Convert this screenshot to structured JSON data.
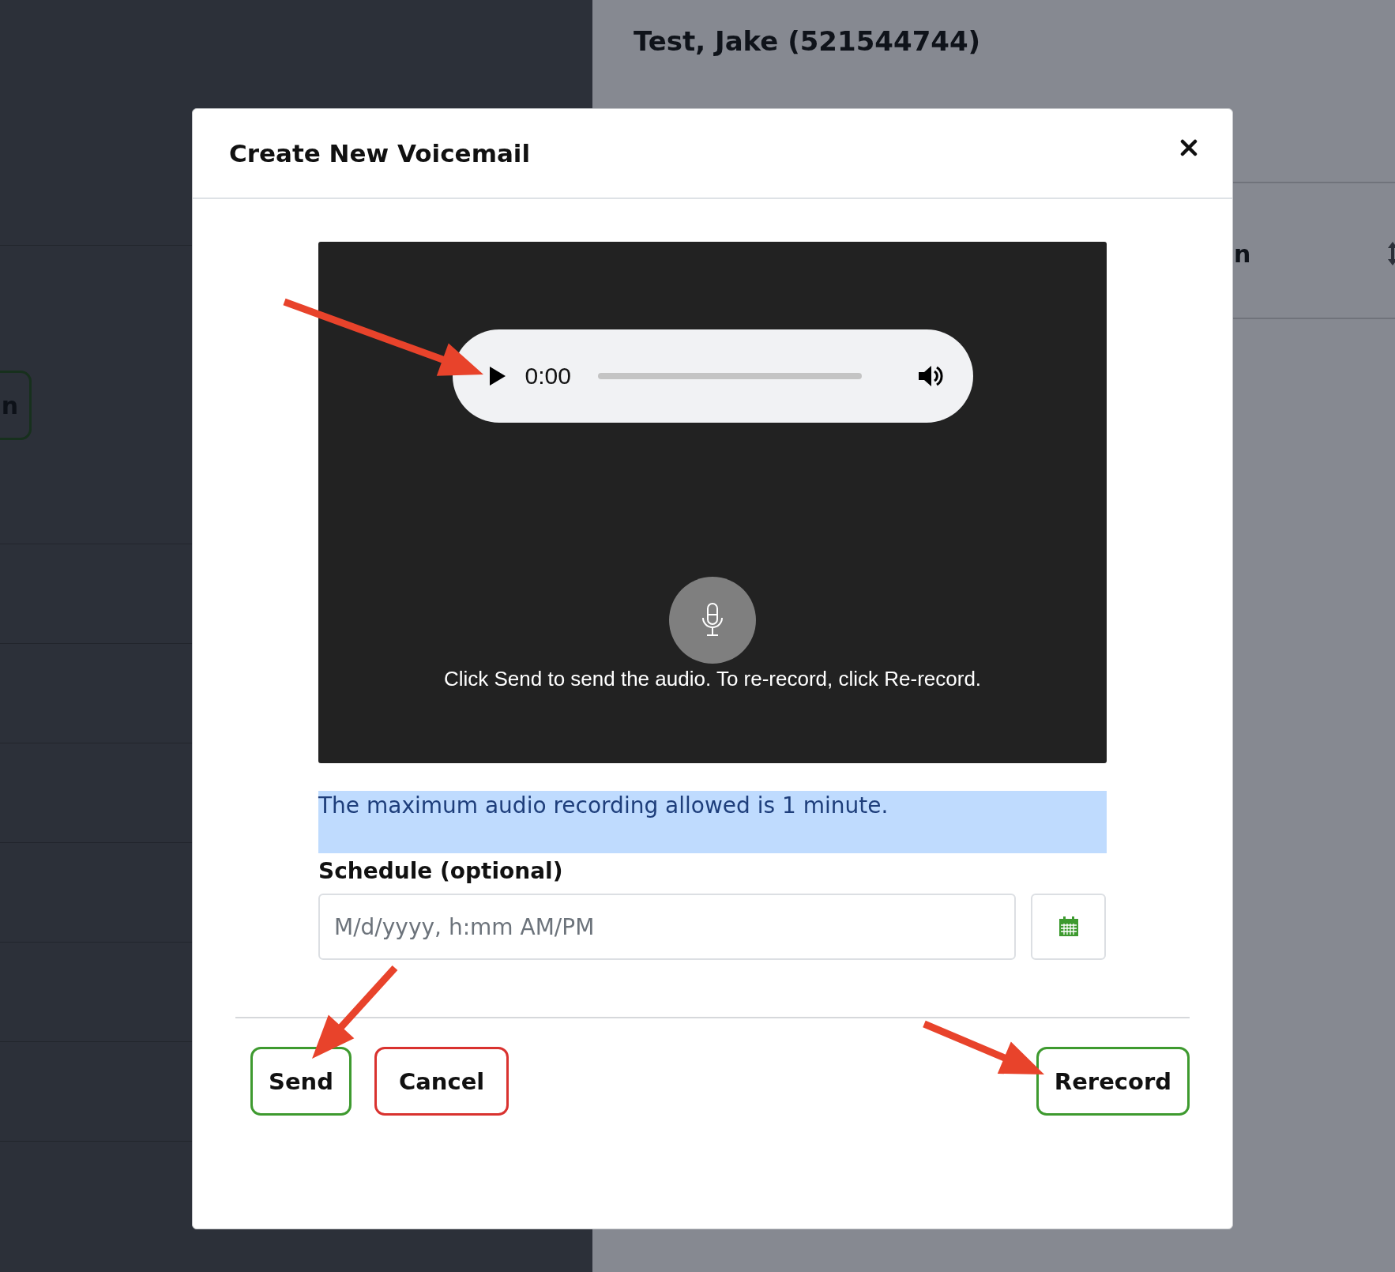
{
  "background": {
    "header_title": "Test, Jake (521544744)",
    "left_button_label": "n",
    "column_header": "n"
  },
  "dialog": {
    "title": "Create New Voicemail",
    "player": {
      "time": "0:00",
      "level": 0
    },
    "caption": "Click Send to send the audio. To re-record, click Re-record.",
    "notice": "The maximum audio recording allowed is 1 minute.",
    "schedule": {
      "label": "Schedule (optional)",
      "placeholder": "M/d/yyyy, h:mm AM/PM"
    },
    "buttons": [
      {
        "label": "Send",
        "kind": "confirm"
      },
      {
        "label": "Cancel",
        "kind": "danger"
      },
      {
        "label": "Rerecord",
        "kind": "confirm"
      }
    ]
  }
}
